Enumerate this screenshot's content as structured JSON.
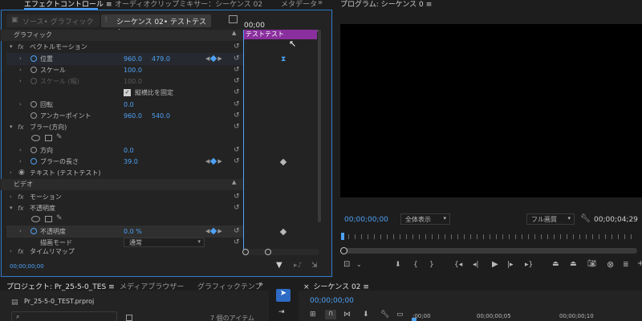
{
  "effect_controls": {
    "tab_title": "エフェクトコントロール",
    "tab_audio_mixer": "オーディオクリップミキサー：シーケンス 02",
    "tab_metadata": "メタデータ",
    "source_label": "ソース• グラフィック",
    "sequence_label": "シーケンス 02• テストテスト",
    "timeline_time": "00;00",
    "clip_name": "テストテスト",
    "section_graphic": "グラフィック",
    "section_video": "ビデオ",
    "time_display": "00;00;00;00",
    "vector_motion": {
      "name": "ベクトルモーション"
    },
    "position": {
      "label": "位置",
      "x": "960.0",
      "y": "479.0"
    },
    "scale": {
      "label": "スケール",
      "value": "100.0"
    },
    "scale_width": {
      "label": "スケール (幅)",
      "value": "100.0"
    },
    "uniform_scale": {
      "label": "縦横比を固定",
      "checked": true
    },
    "rotation": {
      "label": "回転",
      "value": "0.0"
    },
    "anchor": {
      "label": "アンカーポイント",
      "x": "960.0",
      "y": "540.0"
    },
    "blur": {
      "name": "ブラー(方向)"
    },
    "direction": {
      "label": "方向",
      "value": "0.0"
    },
    "blur_length": {
      "label": "ブラーの長さ",
      "value": "39.0"
    },
    "text_layer": {
      "name": "テキスト (テストテスト)"
    },
    "motion": {
      "name": "モーション"
    },
    "opacity_fx": {
      "name": "不透明度"
    },
    "opacity": {
      "label": "不透明度",
      "value": "0.0 %"
    },
    "blend_mode": {
      "label": "描画モード",
      "value": "通常"
    },
    "time_remap": {
      "name": "タイムリマップ"
    }
  },
  "program_monitor": {
    "title": "プログラム: シーケンス 0",
    "timecode": "00;00;00;00",
    "zoom": "全体表示",
    "quality": "フル画質",
    "duration": "00;00;04;29"
  },
  "project": {
    "tab_project": "プロジェクト: Pr_25-5-0_TES",
    "tab_media": "メディアブラウザー",
    "tab_graphic": "グラフィックテンプ",
    "file_name": "Pr_25-5-0_TEST.prproj",
    "item_count": "7 個のアイテム"
  },
  "timeline": {
    "title": "シーケンス 02",
    "timecode": "00;00;00;00",
    "ruler": [
      ":00;00",
      "00;00;00;05",
      "00;00;00;10"
    ]
  }
}
